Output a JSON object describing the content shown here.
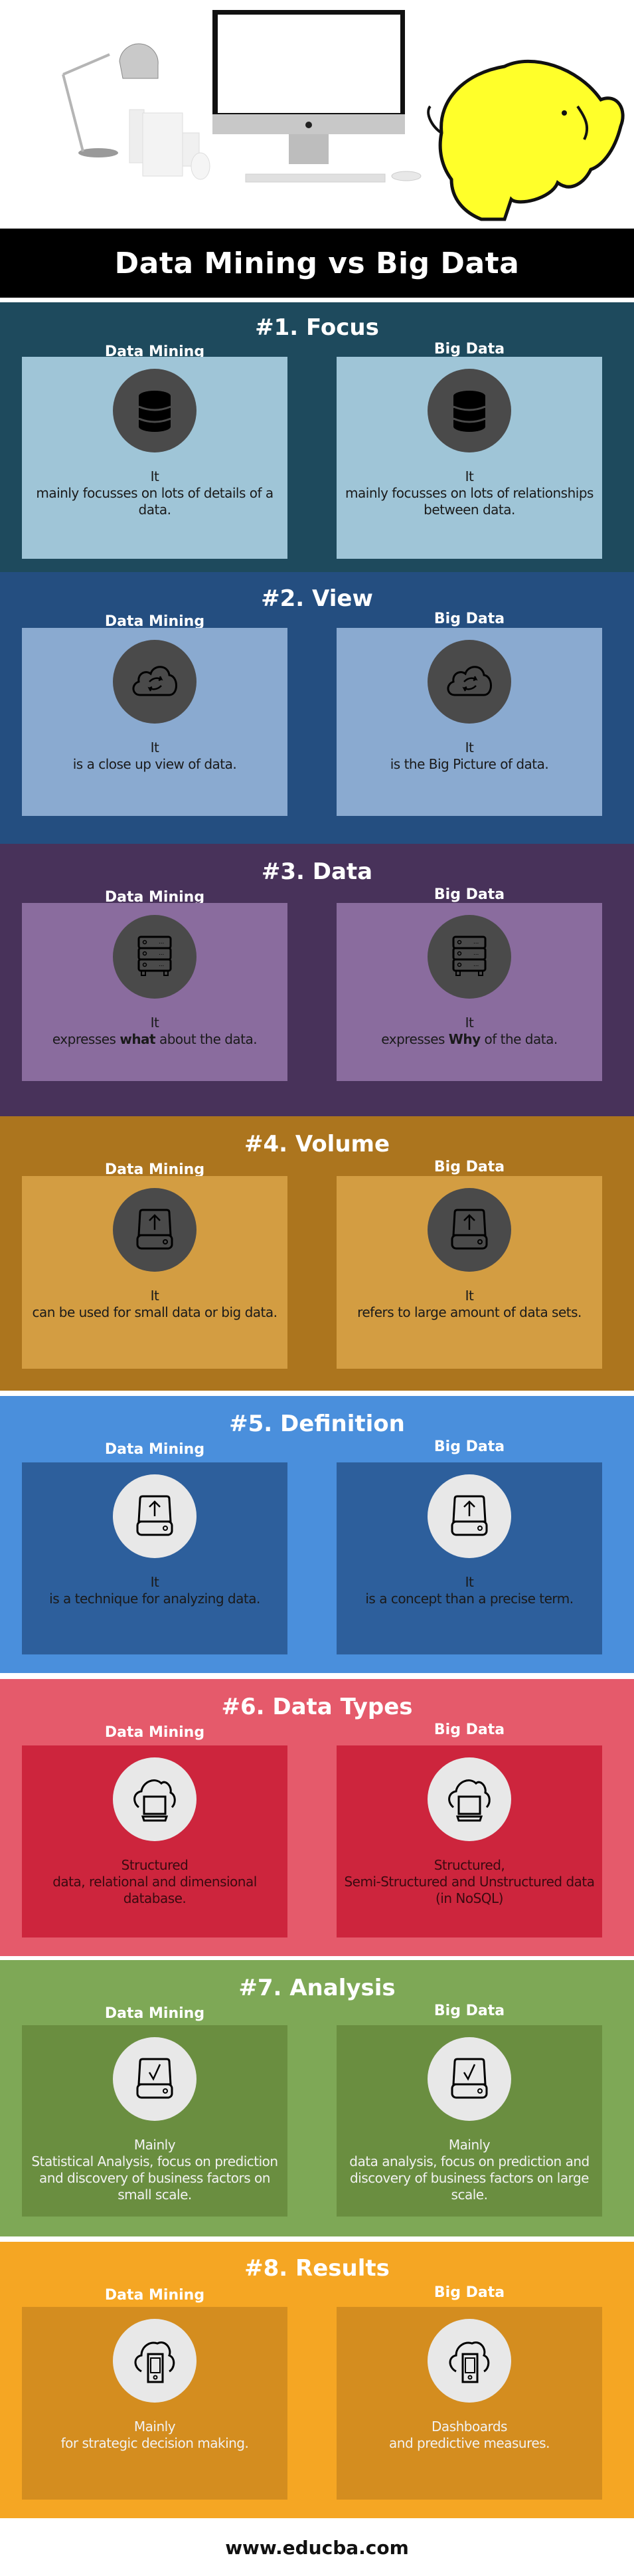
{
  "header": {
    "title": "Data Mining vs Big Data",
    "hero_image": "desk-with-monitor-lamp-and-yellow-elephant"
  },
  "columns": {
    "left": "Data Mining",
    "right": "Big Data"
  },
  "sections": [
    {
      "title": "#1. Focus",
      "colors": {
        "bg": "#1e4a5d",
        "card": "#9fc5d7",
        "circle": "#4a4a4a",
        "text": "#1a1a1a"
      },
      "icon": "database-icon",
      "left": {
        "lead": "It",
        "text": "mainly focusses on lots of details of a data."
      },
      "right": {
        "lead": "It",
        "text": "mainly focusses on lots of relationships between data."
      }
    },
    {
      "title": "#2. View",
      "colors": {
        "bg": "#244e80",
        "card": "#8aaad0",
        "circle": "#4a4a4a",
        "text": "#1a1a1a"
      },
      "icon": "cloud-sync-icon",
      "left": {
        "lead": "It",
        "text": "is a close up view of data."
      },
      "right": {
        "lead": "It",
        "text": "is the Big Picture of data."
      }
    },
    {
      "title": "#3. Data",
      "colors": {
        "bg": "#48325a",
        "card": "#8a6c9e",
        "circle": "#4a4a4a",
        "text": "#1a1a1a"
      },
      "icon": "server-icon",
      "left": {
        "lead": "It",
        "text_before": "expresses ",
        "bold": "what",
        "text_after": " about the data."
      },
      "right": {
        "lead": "It",
        "text_before": "expresses ",
        "bold": "Why",
        "text_after": " of the data."
      }
    },
    {
      "title": "#4. Volume",
      "colors": {
        "bg": "#ac751e",
        "card": "#d39d42",
        "circle": "#4a4a4a",
        "text": "#1a1a1a"
      },
      "icon": "drive-upload-icon",
      "left": {
        "lead": "It",
        "text": "can be used for small data or big data."
      },
      "right": {
        "lead": "It",
        "text": "refers to large amount of data sets."
      }
    },
    {
      "title": "#5. Definition",
      "colors": {
        "bg": "#4a8fdc",
        "card": "#2d5f9c",
        "circle": "#e8e8e8",
        "text": "#1a1a1a"
      },
      "icon": "drive-upload-icon",
      "left": {
        "lead": "It",
        "text": "is a technique for analyzing data."
      },
      "right": {
        "lead": "It",
        "text": "is a concept than a precise term."
      }
    },
    {
      "title": "#6. Data Types",
      "colors": {
        "bg": "#e55a6b",
        "card": "#cd253d",
        "circle": "#e8e8e8",
        "text": "#3a0a10"
      },
      "icon": "cloud-computer-icon",
      "left": {
        "lead": "Structured",
        "text": "data, relational and dimensional database."
      },
      "right": {
        "lead": "Structured,",
        "text": "Semi-Structured and Unstructured data (in NoSQL)"
      }
    },
    {
      "title": "#7. Analysis",
      "colors": {
        "bg": "#7ea856",
        "card": "#6a8e40",
        "circle": "#e8e8e8",
        "text": "#f2f2f2"
      },
      "icon": "drive-check-icon",
      "left": {
        "lead": "Mainly",
        "text": "Statistical Analysis, focus on prediction and discovery of business factors on small scale."
      },
      "right": {
        "lead": "Mainly",
        "text": "data analysis, focus on prediction and discovery of business factors on large scale."
      }
    },
    {
      "title": "#8. Results",
      "colors": {
        "bg": "#f5a623",
        "card": "#d48d1f",
        "circle": "#e8e8e8",
        "text": "#f2f2f2"
      },
      "icon": "cloud-mobile-icon",
      "left": {
        "lead": "Mainly",
        "text": "for strategic decision making."
      },
      "right": {
        "lead": "Dashboards",
        "text": "and predictive measures."
      }
    }
  ],
  "footer": {
    "url": "www.educba.com"
  }
}
